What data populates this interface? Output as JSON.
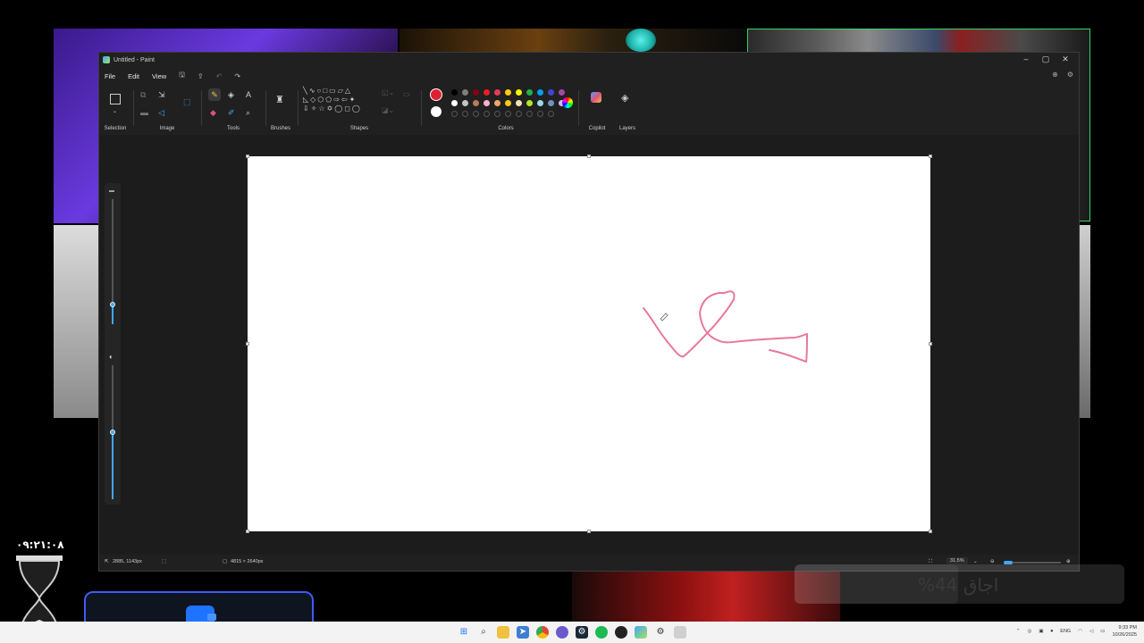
{
  "window": {
    "title": "Untitled - Paint",
    "controls": [
      "minimize",
      "maximize",
      "close"
    ]
  },
  "menu": {
    "file": "File",
    "edit": "Edit",
    "view": "View"
  },
  "ribbon": {
    "selection_label": "Selection",
    "image_label": "Image",
    "tools_label": "Tools",
    "brushes_label": "Brushes",
    "shapes_label": "Shapes",
    "colors_label": "Colors",
    "copilot_label": "Copilot",
    "layers_label": "Layers",
    "active_color": "#e02030",
    "secondary_color": "#ffffff",
    "palette_row1": [
      "#000000",
      "#7f7f7f",
      "#880015",
      "#ed1c24",
      "#e83a5a",
      "#ffc90e",
      "#fff200",
      "#22b14c",
      "#00a2e8",
      "#3f48cc",
      "#a349a4"
    ],
    "palette_row2": [
      "#ffffff",
      "#c3c3c3",
      "#b97a57",
      "#ffaec9",
      "#f4a460",
      "#ffc90e",
      "#efe4b0",
      "#b5e61d",
      "#99d9ea",
      "#7092be",
      "#c8bfe7"
    ]
  },
  "status": {
    "cursor_pos": "2885, 1143px",
    "canvas_size": "4815 × 2640px",
    "zoom": "31.5%"
  },
  "overlays": {
    "clock": "۰۹:۲۱:۰۸",
    "battery": "اجاق 44%"
  },
  "taskbar": {
    "language": "ENG",
    "time": "9:33 PM",
    "date": "10/26/2025"
  },
  "icons": {
    "app": "paint-icon",
    "wallet": "wallet-icon"
  }
}
